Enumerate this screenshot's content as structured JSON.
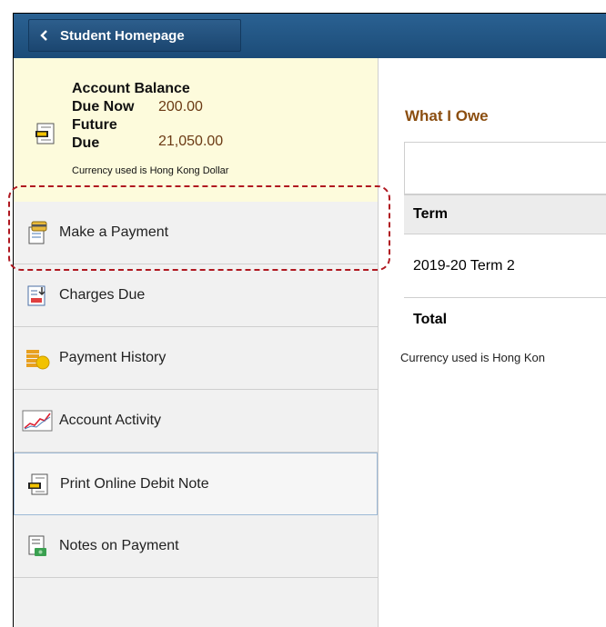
{
  "header": {
    "back_label": "Student Homepage"
  },
  "balance": {
    "title": "Account Balance",
    "due_now_label": "Due Now",
    "due_now_value": "200.00",
    "future_label_1": "Future",
    "future_label_2": "Due",
    "future_value": "21,050.00",
    "currency_note": "Currency used is Hong Kong Dollar"
  },
  "sidebar": {
    "items": [
      {
        "label": "Make a Payment",
        "icon": "payment-icon"
      },
      {
        "label": "Charges Due",
        "icon": "charges-icon"
      },
      {
        "label": "Payment History",
        "icon": "coins-icon"
      },
      {
        "label": "Account Activity",
        "icon": "line-chart-icon"
      },
      {
        "label": "Print Online Debit Note",
        "icon": "debit-note-icon"
      },
      {
        "label": "Notes on Payment",
        "icon": "notes-icon"
      }
    ]
  },
  "main": {
    "title": "What I Owe",
    "table": {
      "header": "Term",
      "rows": [
        "2019-20 Term 2"
      ],
      "total_label": "Total"
    },
    "currency_note": "Currency used is Hong Kon"
  },
  "colors": {
    "header_bg": "#1c4c78",
    "title_color": "#8b4e10",
    "highlight": "#b01820"
  }
}
